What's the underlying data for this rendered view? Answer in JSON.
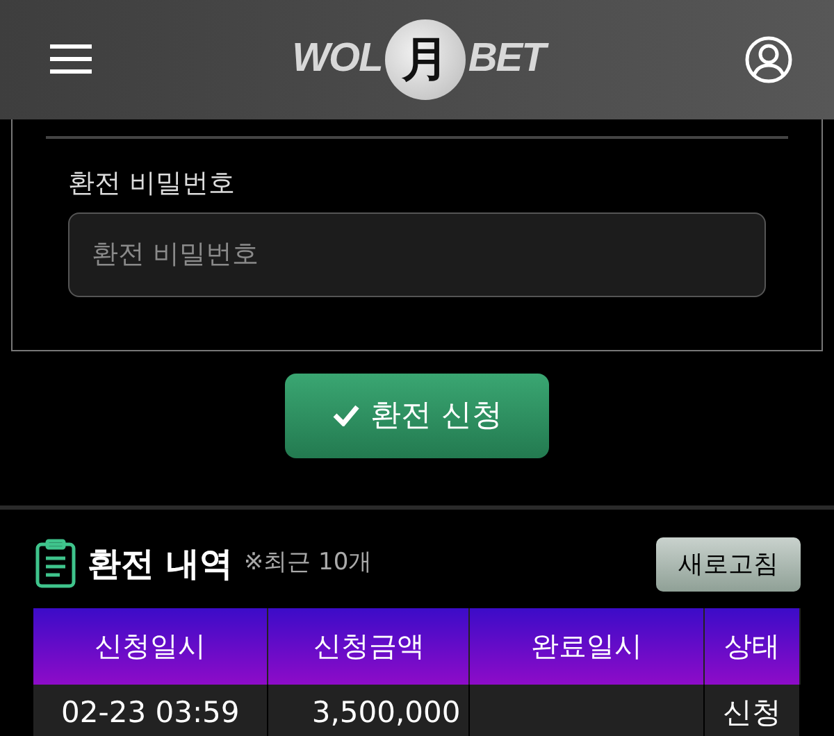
{
  "header": {
    "logo": {
      "left": "WOL",
      "mark": "月",
      "right": "BET"
    }
  },
  "form": {
    "label": "환전 비밀번호",
    "placeholder": "환전 비밀번호",
    "submit": "환전 신청"
  },
  "history": {
    "title": "환전 내역",
    "note": "※최근 10개",
    "refresh": "새로고침",
    "columns": [
      "신청일시",
      "신청금액",
      "완료일시",
      "상태"
    ],
    "rows": [
      {
        "requested_at": "02-23 03:59",
        "amount": "3,500,000",
        "status": "신청"
      }
    ]
  }
}
